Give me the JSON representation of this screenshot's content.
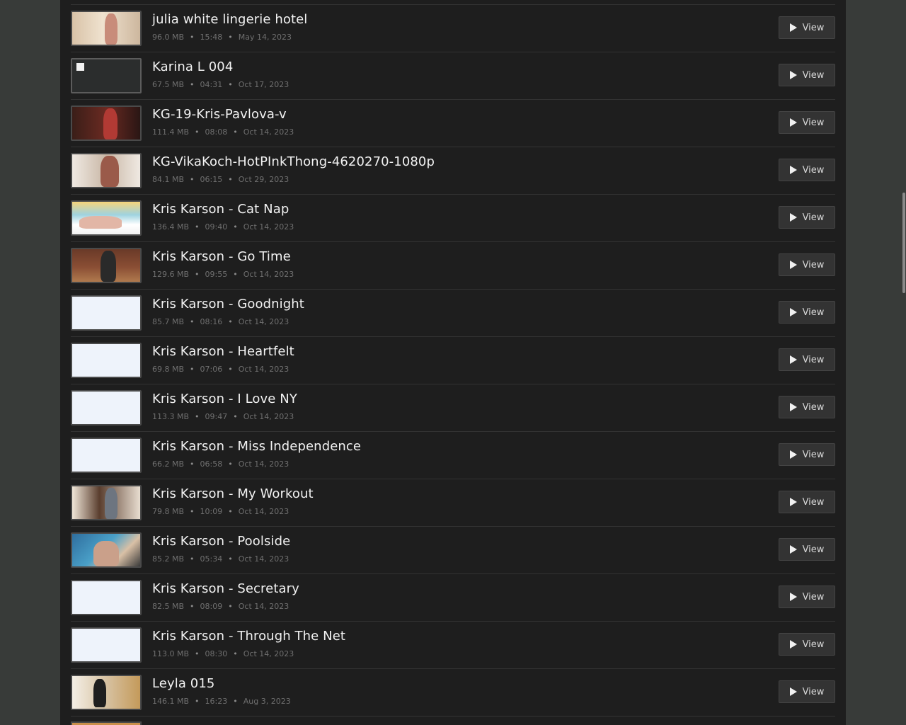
{
  "media_list": {
    "items": [
      {
        "title": "julia white lingerie hotel",
        "size": "96.0 MB",
        "duration": "15:48",
        "date": "May 14, 2023",
        "thumb": "photo",
        "view_label": "View"
      },
      {
        "title": "Karina L 004",
        "size": "67.5 MB",
        "duration": "04:31",
        "date": "Oct 17, 2023",
        "thumb": "broken",
        "view_label": "View"
      },
      {
        "title": "KG-19-Kris-Pavlova-v",
        "size": "111.4 MB",
        "duration": "08:08",
        "date": "Oct 14, 2023",
        "thumb": "photo",
        "view_label": "View"
      },
      {
        "title": "KG-VikaKoch-HotPInkThong-4620270-1080p",
        "size": "84.1 MB",
        "duration": "06:15",
        "date": "Oct 29, 2023",
        "thumb": "photo",
        "view_label": "View"
      },
      {
        "title": "Kris Karson - Cat Nap",
        "size": "136.4 MB",
        "duration": "09:40",
        "date": "Oct 14, 2023",
        "thumb": "photo",
        "view_label": "View"
      },
      {
        "title": "Kris Karson - Go Time",
        "size": "129.6 MB",
        "duration": "09:55",
        "date": "Oct 14, 2023",
        "thumb": "photo",
        "view_label": "View"
      },
      {
        "title": "Kris Karson - Goodnight",
        "size": "85.7 MB",
        "duration": "08:16",
        "date": "Oct 14, 2023",
        "thumb": "blank",
        "view_label": "View"
      },
      {
        "title": "Kris Karson - Heartfelt",
        "size": "69.8 MB",
        "duration": "07:06",
        "date": "Oct 14, 2023",
        "thumb": "blank",
        "view_label": "View"
      },
      {
        "title": "Kris Karson - I Love NY",
        "size": "113.3 MB",
        "duration": "09:47",
        "date": "Oct 14, 2023",
        "thumb": "blank",
        "view_label": "View"
      },
      {
        "title": "Kris Karson - Miss Independence",
        "size": "66.2 MB",
        "duration": "06:58",
        "date": "Oct 14, 2023",
        "thumb": "blank",
        "view_label": "View"
      },
      {
        "title": "Kris Karson - My Workout",
        "size": "79.8 MB",
        "duration": "10:09",
        "date": "Oct 14, 2023",
        "thumb": "photo",
        "view_label": "View"
      },
      {
        "title": "Kris Karson - Poolside",
        "size": "85.2 MB",
        "duration": "05:34",
        "date": "Oct 14, 2023",
        "thumb": "photo",
        "view_label": "View"
      },
      {
        "title": "Kris Karson - Secretary",
        "size": "82.5 MB",
        "duration": "08:09",
        "date": "Oct 14, 2023",
        "thumb": "blank",
        "view_label": "View"
      },
      {
        "title": "Kris Karson - Through The Net",
        "size": "113.0 MB",
        "duration": "08:30",
        "date": "Oct 14, 2023",
        "thumb": "blank",
        "view_label": "View"
      },
      {
        "title": "Leyla 015",
        "size": "146.1 MB",
        "duration": "16:23",
        "date": "Aug 3, 2023",
        "thumb": "photo",
        "view_label": "View"
      }
    ]
  },
  "meta_separator": "•",
  "colors": {
    "page_bg": "#383b39",
    "panel_bg": "#1e1e1e",
    "title_text": "#f2f2f2",
    "meta_text": "#6f6f6f",
    "button_bg": "#333333"
  }
}
